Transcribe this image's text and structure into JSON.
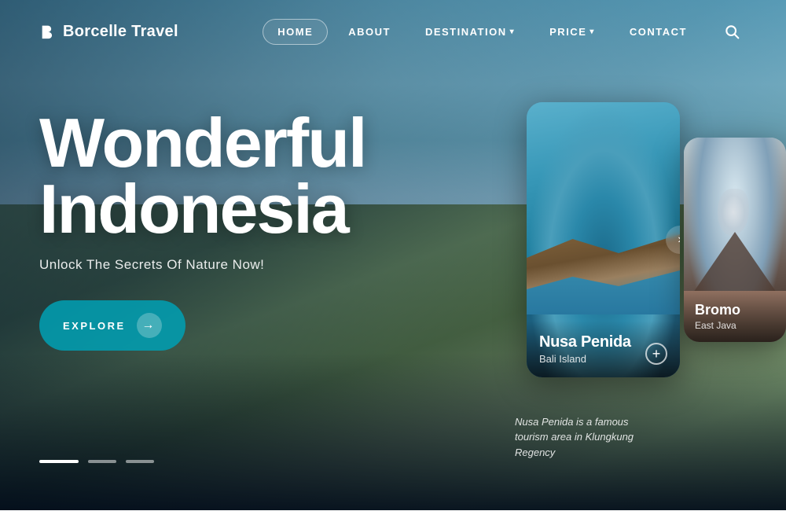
{
  "brand": {
    "name": "Borcelle Travel",
    "logo_icon": "b-icon"
  },
  "nav": {
    "items": [
      {
        "label": "HOME",
        "active": true,
        "has_dropdown": false
      },
      {
        "label": "ABOUT",
        "active": false,
        "has_dropdown": false
      },
      {
        "label": "DESTINATION",
        "active": false,
        "has_dropdown": true
      },
      {
        "label": "PRICE",
        "active": false,
        "has_dropdown": true
      },
      {
        "label": "CONTACT",
        "active": false,
        "has_dropdown": false
      }
    ]
  },
  "hero": {
    "title_line1": "Wonderful",
    "title_line2": "Indonesia",
    "subtitle": "Unlock The Secrets Of Nature Now!",
    "cta_label": "EXPLORE",
    "pagination": [
      {
        "active": true
      },
      {
        "active": false
      },
      {
        "active": false
      }
    ]
  },
  "cards": [
    {
      "id": "nusa-penida",
      "name": "Nusa Penida",
      "sub": "Bali Island",
      "description": "Nusa Penida is a famous tourism area in Klungkung Regency",
      "is_primary": true
    },
    {
      "id": "bromo",
      "name": "Bromo",
      "sub": "East Java",
      "is_primary": false
    }
  ]
}
